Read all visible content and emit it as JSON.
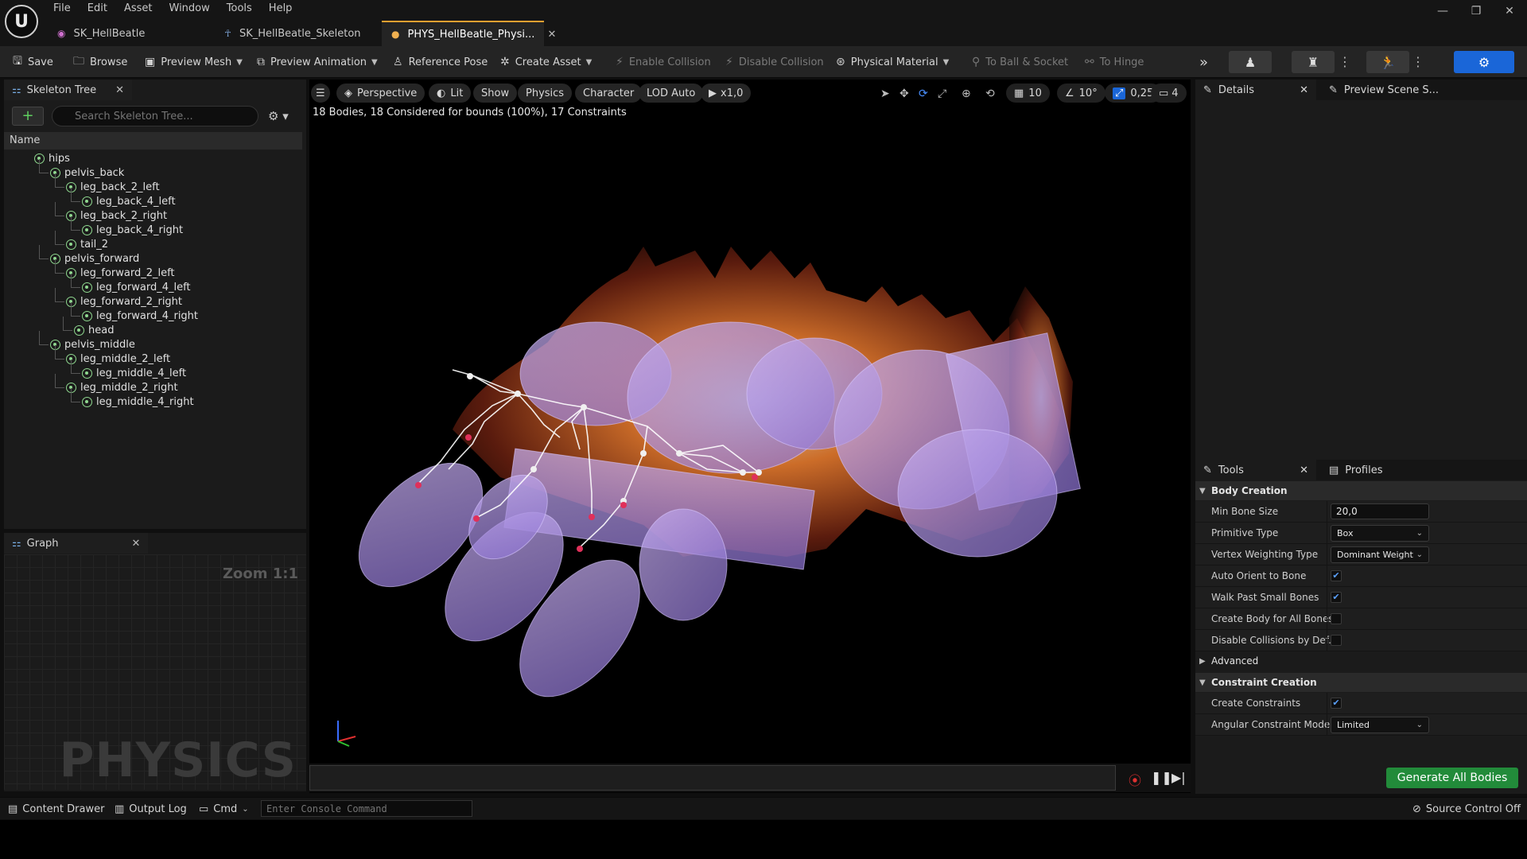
{
  "app": {
    "logo": "U",
    "menu": [
      "File",
      "Edit",
      "Asset",
      "Window",
      "Tools",
      "Help"
    ],
    "tabs": [
      {
        "label": "SK_HellBeatle",
        "icon": "skeletal-mesh-icon"
      },
      {
        "label": "SK_HellBeatle_Skeleton",
        "icon": "skeleton-icon"
      },
      {
        "label": "PHYS_HellBeatle_Physi...",
        "icon": "physics-asset-icon",
        "active": true
      }
    ]
  },
  "toolbar": {
    "save": "Save",
    "browse": "Browse",
    "preview_mesh": "Preview Mesh",
    "preview_animation": "Preview Animation",
    "reference_pose": "Reference Pose",
    "create_asset": "Create Asset",
    "enable_collision": "Enable Collision",
    "disable_collision": "Disable Collision",
    "physical_material": "Physical Material",
    "to_ball_socket": "To Ball & Socket",
    "to_hinge": "To Hinge"
  },
  "skeleton_tree": {
    "tab": "Skeleton Tree",
    "search_placeholder": "Search Skeleton Tree...",
    "column": "Name",
    "bones": [
      {
        "name": "hips",
        "depth": 0
      },
      {
        "name": "pelvis_back",
        "depth": 1
      },
      {
        "name": "leg_back_2_left",
        "depth": 2
      },
      {
        "name": "leg_back_4_left",
        "depth": 3
      },
      {
        "name": "leg_back_2_right",
        "depth": 2
      },
      {
        "name": "leg_back_4_right",
        "depth": 3
      },
      {
        "name": "tail_2",
        "depth": 2
      },
      {
        "name": "pelvis_forward",
        "depth": 1
      },
      {
        "name": "leg_forward_2_left",
        "depth": 2
      },
      {
        "name": "leg_forward_4_left",
        "depth": 3
      },
      {
        "name": "leg_forward_2_right",
        "depth": 2
      },
      {
        "name": "leg_forward_4_right",
        "depth": 3
      },
      {
        "name": "head",
        "depth": 2.5
      },
      {
        "name": "pelvis_middle",
        "depth": 1
      },
      {
        "name": "leg_middle_2_left",
        "depth": 2
      },
      {
        "name": "leg_middle_4_left",
        "depth": 3
      },
      {
        "name": "leg_middle_2_right",
        "depth": 2
      },
      {
        "name": "leg_middle_4_right",
        "depth": 3
      }
    ]
  },
  "graph": {
    "tab": "Graph",
    "zoom": "Zoom 1:1",
    "watermark": "PHYSICS"
  },
  "viewport": {
    "perspective": "Perspective",
    "lit": "Lit",
    "show": "Show",
    "physics": "Physics",
    "character": "Character",
    "lod": "LOD Auto",
    "play_rate": "x1,0",
    "grid_snap": "10",
    "rotation_snap": "10°",
    "scale_snap": "0,25",
    "camera_speed": "4",
    "stats": "18 Bodies, 18 Considered for bounds (100%), 17 Constraints"
  },
  "details": {
    "tab": "Details",
    "preview_tab": "Preview Scene S..."
  },
  "tools": {
    "tab": "Tools",
    "profiles_tab": "Profiles",
    "body_creation": "Body Creation",
    "min_bone_size_label": "Min Bone Size",
    "min_bone_size": "20,0",
    "primitive_type_label": "Primitive Type",
    "primitive_type": "Box",
    "vertex_weighting_label": "Vertex Weighting Type",
    "vertex_weighting": "Dominant Weight",
    "auto_orient_label": "Auto Orient to Bone",
    "auto_orient": true,
    "walk_past_label": "Walk Past Small Bones",
    "walk_past": true,
    "create_body_all_label": "Create Body for All Bones",
    "create_body_all": false,
    "disable_collisions_label": "Disable Collisions by Def...",
    "disable_collisions": false,
    "advanced": "Advanced",
    "constraint_creation": "Constraint Creation",
    "create_constraints_label": "Create Constraints",
    "create_constraints": true,
    "angular_mode_label": "Angular Constraint Mode",
    "angular_mode": "Limited",
    "generate": "Generate All Bodies"
  },
  "statusbar": {
    "content_drawer": "Content Drawer",
    "output_log": "Output Log",
    "cmd": "Cmd",
    "console_placeholder": "Enter Console Command",
    "source_control": "Source Control Off"
  }
}
